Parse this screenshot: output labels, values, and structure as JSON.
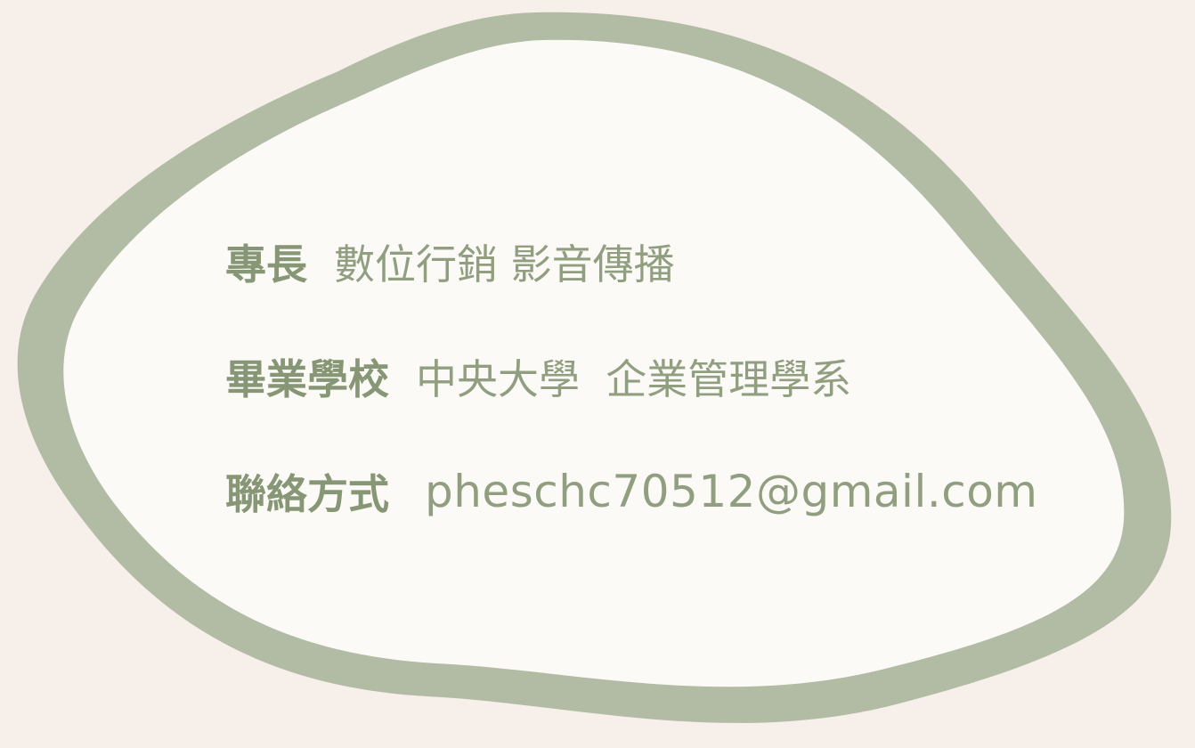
{
  "profile": {
    "rows": [
      {
        "label": "專長",
        "value": "數位行銷 影音傳播"
      },
      {
        "label": "畢業學校",
        "value": "中央大學  企業管理學系"
      },
      {
        "label": "聯絡方式",
        "value": "pheschc70512@gmail.com"
      }
    ]
  },
  "colors": {
    "background": "#f6efea",
    "blob_border": "#b2bca4",
    "blob_fill": "#fbfaf7",
    "label_text": "#879675",
    "value_text": "#919f80"
  }
}
